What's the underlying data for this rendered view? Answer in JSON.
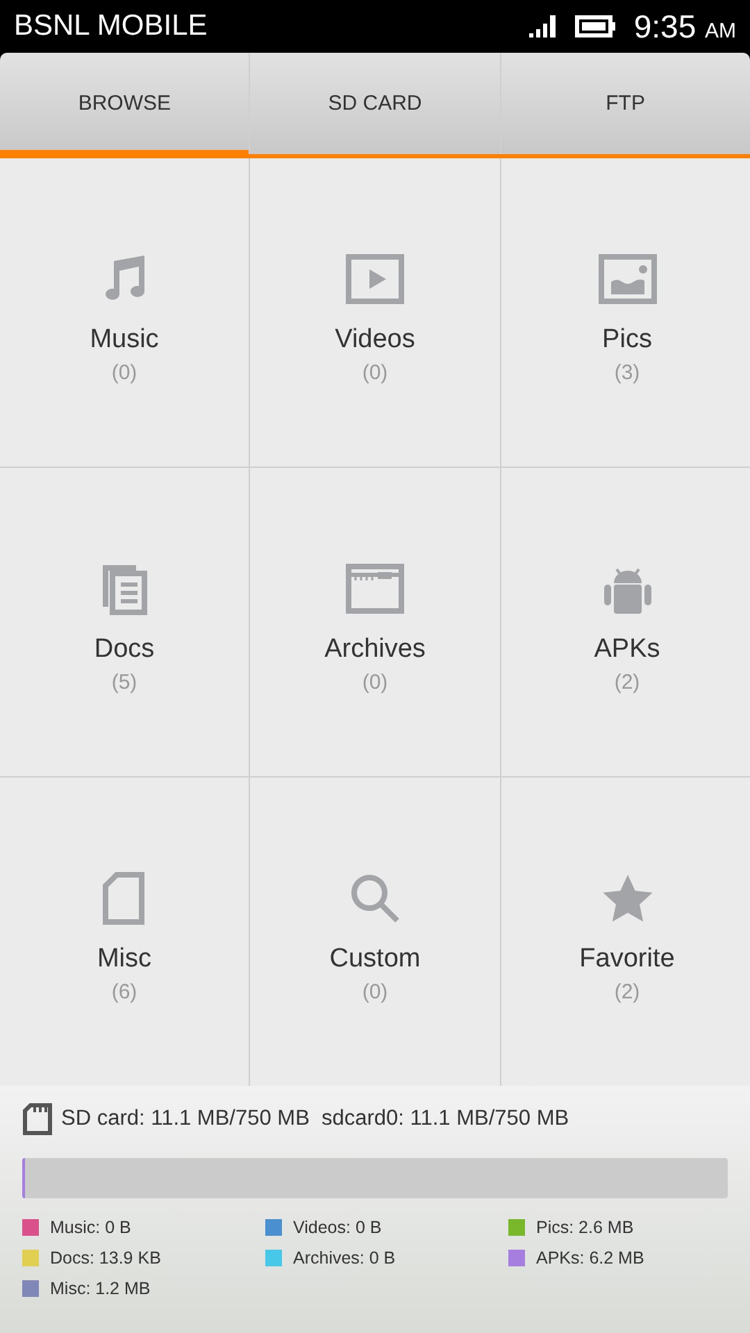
{
  "status_bar": {
    "carrier": "BSNL MOBILE",
    "time": "9:35",
    "ampm": "AM"
  },
  "tabs": [
    {
      "label": "BROWSE",
      "selected": true
    },
    {
      "label": "SD CARD",
      "selected": false
    },
    {
      "label": "FTP",
      "selected": false
    }
  ],
  "categories": [
    {
      "kind": "music",
      "label": "Music",
      "count": "(0)"
    },
    {
      "kind": "video",
      "label": "Videos",
      "count": "(0)"
    },
    {
      "kind": "image",
      "label": "Pics",
      "count": "(3)"
    },
    {
      "kind": "docs",
      "label": "Docs",
      "count": "(5)"
    },
    {
      "kind": "archive",
      "label": "Archives",
      "count": "(0)"
    },
    {
      "kind": "android",
      "label": "APKs",
      "count": "(2)"
    },
    {
      "kind": "file",
      "label": "Misc",
      "count": "(6)"
    },
    {
      "kind": "search",
      "label": "Custom",
      "count": "(0)"
    },
    {
      "kind": "star",
      "label": "Favorite",
      "count": "(2)"
    }
  ],
  "storage": {
    "summary": "SD card: 11.1 MB/750 MB  sdcard0: 11.1 MB/750 MB",
    "level": 0.004,
    "legend": [
      {
        "label": "Music: 0 B",
        "color": "#d9508a"
      },
      {
        "label": "Videos: 0 B",
        "color": "#4a90d0"
      },
      {
        "label": "Pics: 2.6 MB",
        "color": "#78b82a"
      },
      {
        "label": "Docs: 13.9 KB",
        "color": "#e0cf50"
      },
      {
        "label": "Archives: 0 B",
        "color": "#48c8e8"
      },
      {
        "label": "APKs: 6.2 MB",
        "color": "#a57ee0"
      },
      {
        "label": "Misc: 1.2 MB",
        "color": "#8088b8"
      }
    ]
  }
}
